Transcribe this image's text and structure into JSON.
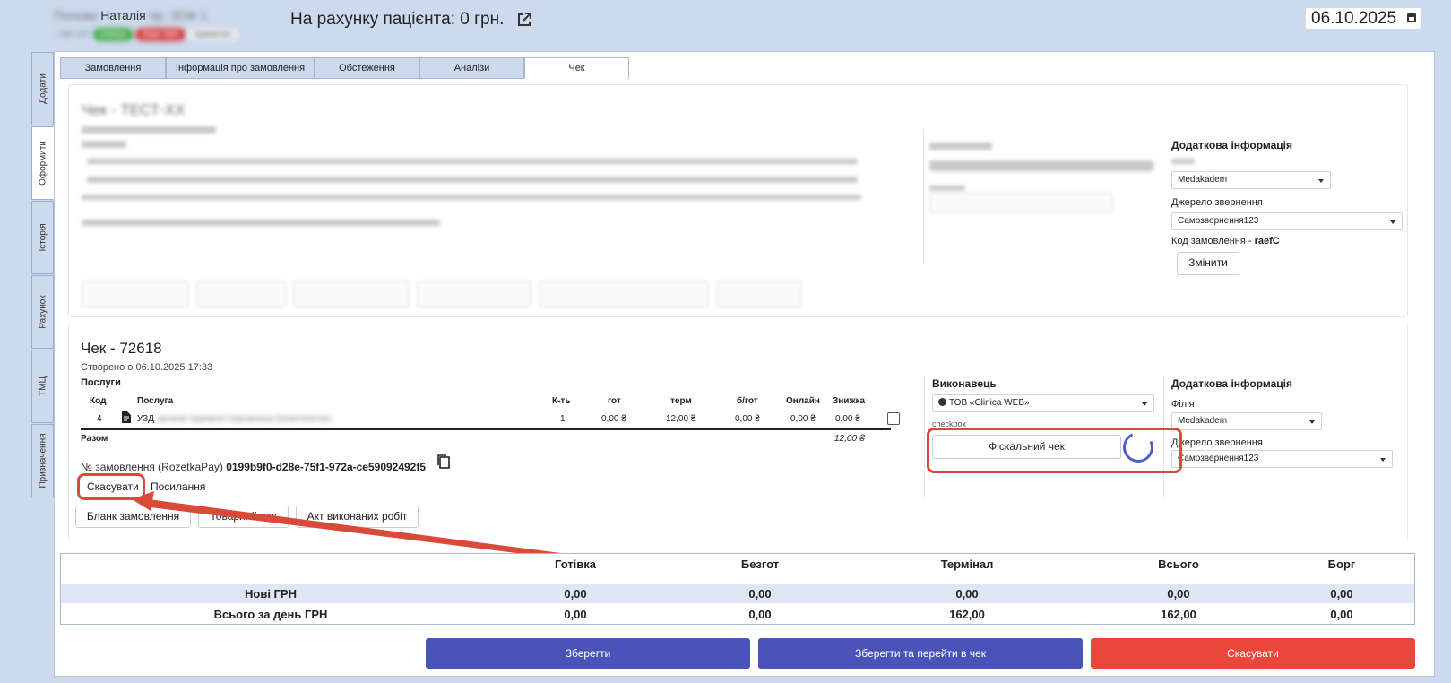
{
  "header": {
    "patient_first_name": "Наталія",
    "balance_text": "На рахунку пацієнта: 0 грн.",
    "date": "06.10.2025"
  },
  "side_tabs": [
    "Додати",
    "Оформити",
    "Історія",
    "Рахунок",
    "ТМЦ",
    "Призначення"
  ],
  "tabs": [
    "Замовлення",
    "Інформація про замовлення",
    "Обстеження",
    "Аналізи",
    "Чек"
  ],
  "blurred_card": {
    "additional_info_label": "Додаткова інформація",
    "branch_value": "Medakadem",
    "source_label": "Джерело звернення",
    "source_value": "Самозвернення123",
    "order_code_label": "Код замовлення - ",
    "order_code_value": "raefC",
    "button_label": "Змінити"
  },
  "check": {
    "title": "Чек - 72618",
    "created": "Створено о 06.10.2025 17:33",
    "services_label": "Послуги",
    "columns": [
      "Код",
      "Послуга",
      "К-ть",
      "гот",
      "терм",
      "б/гот",
      "Онлайн",
      "Знижка"
    ],
    "row": {
      "code": "4",
      "service": "УЗД",
      "qty": "1",
      "cash": "0,00 ₴",
      "terminal": "12,00 ₴",
      "noncash": "0,00 ₴",
      "online": "0,00 ₴",
      "discount": "0,00 ₴"
    },
    "total_label": "Разом",
    "total_value": "12,00 ₴",
    "order_label": "№ замовлення (RozetkaPay)",
    "order_id": "0199b9f0-d28e-75f1-972a-ce59092492f5",
    "cancel_link": "Скасувати",
    "link_label": "Посилання",
    "buttons": [
      "Бланк замовлення",
      "Товарний чек",
      "Акт виконаних робіт"
    ],
    "executor_label": "Виконавець",
    "executor_value": "ТОВ «Clinica WEB»",
    "checkbox_label": "checkbox",
    "fiscal_button": "Фіскальний чек",
    "additional_info_label": "Додаткова інформація",
    "branch_label": "Філія",
    "branch_value": "Medakadem",
    "source_label": "Джерело звернення",
    "source_value": "Самозвернення123"
  },
  "summary": {
    "headers": [
      "Готівка",
      "Безгот",
      "Термінал",
      "Всього",
      "Борг"
    ],
    "rows": [
      {
        "label": "Нові ГРН",
        "values": [
          "0,00",
          "0,00",
          "0,00",
          "0,00",
          "0,00"
        ]
      },
      {
        "label": "Всього за день ГРН",
        "values": [
          "0,00",
          "0,00",
          "162,00",
          "162,00",
          "0,00"
        ]
      }
    ]
  },
  "footer": {
    "save": "Зберегти",
    "save_and_go": "Зберегти та перейти в чек",
    "cancel": "Скасувати"
  },
  "colors": {
    "background": "#cdd9ec",
    "primary_button": "#4a54b8",
    "danger_button": "#e8473a",
    "highlight": "#d94a3a",
    "spinner": "#4f5fd1"
  }
}
